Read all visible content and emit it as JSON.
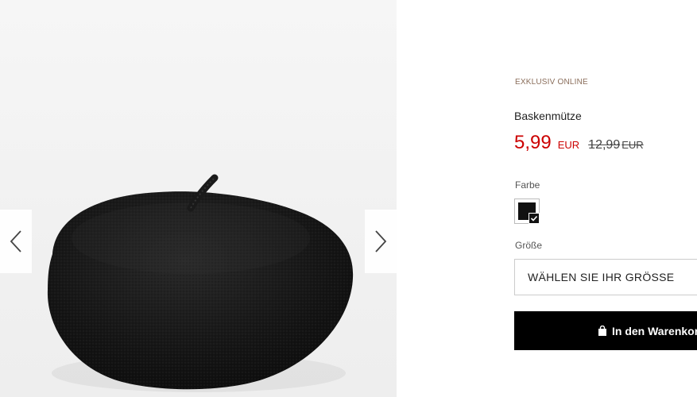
{
  "gallery": {
    "image_subject": "black beret",
    "prev_icon": "chevron-left-icon",
    "next_icon": "chevron-right-icon"
  },
  "product": {
    "badge": "EXKLUSIV ONLINE",
    "name": "Baskenmütze",
    "price_new": "5,99",
    "currency_new": "EUR",
    "price_old": "12,99",
    "currency_old": "EUR"
  },
  "color": {
    "label": "Farbe",
    "selected_swatch_color": "#111111",
    "check_icon": "checkmark-icon"
  },
  "size": {
    "label": "Größe",
    "placeholder": "WÄHLEN SIE IHR GRÖSSE"
  },
  "cart": {
    "icon": "shopping-bag-icon",
    "label": "In den Warenkorb"
  },
  "colors": {
    "sale_red": "#cc0000",
    "badge_brown": "#8a6d5a",
    "button_black": "#000000"
  }
}
